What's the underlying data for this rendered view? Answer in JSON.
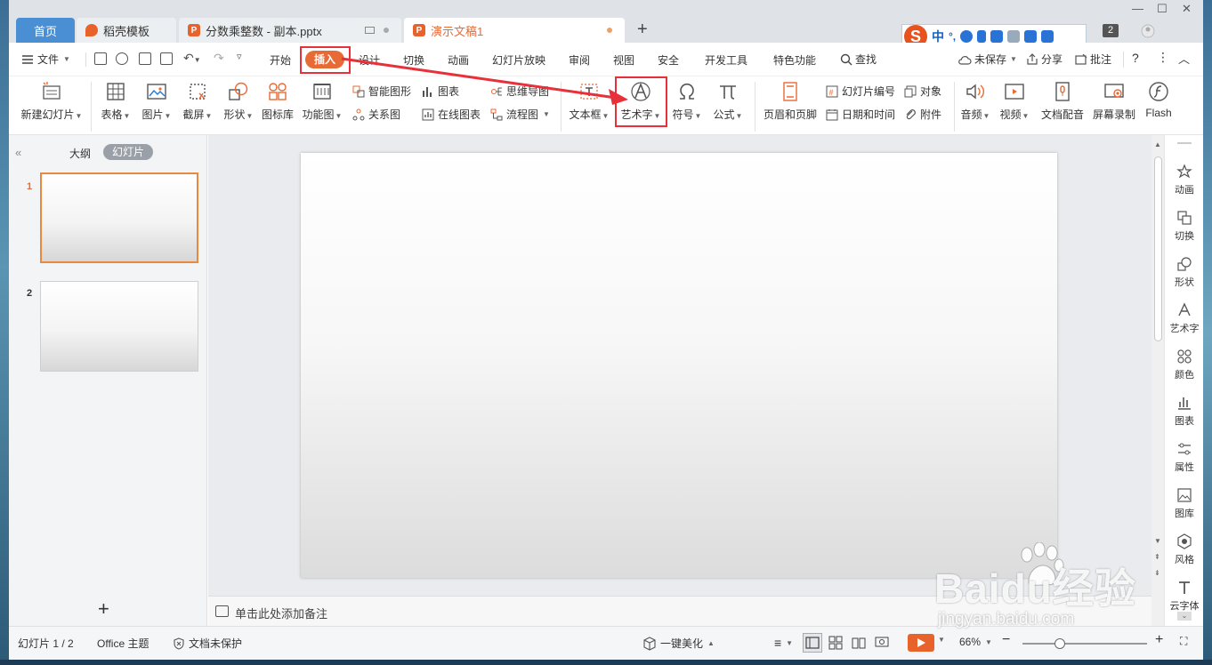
{
  "tabs": [
    {
      "label": "首页"
    },
    {
      "label": "稻壳模板"
    },
    {
      "label": "分数乘整数 - 副本.pptx"
    },
    {
      "label": "演示文稿1"
    }
  ],
  "titlebar": {
    "badge": "2"
  },
  "ime": {
    "label": "中"
  },
  "menu": {
    "file": "文件",
    "items": [
      "开始",
      "插入",
      "设计",
      "切换",
      "动画",
      "幻灯片放映",
      "审阅",
      "视图",
      "安全",
      "开发工具",
      "特色功能"
    ],
    "search": "查找",
    "unsaved": "未保存",
    "share": "分享",
    "annotate": "批注",
    "help": "?"
  },
  "ribbon": {
    "new_slide": "新建幻灯片",
    "table": "表格",
    "picture": "图片",
    "screenshot": "截屏",
    "shape": "形状",
    "icon_lib": "图标库",
    "func_chart": "功能图",
    "smart_shape": "智能图形",
    "relation": "关系图",
    "chart": "图表",
    "online_chart": "在线图表",
    "mindmap": "思维导图",
    "flowchart": "流程图",
    "textbox": "文本框",
    "wordart": "艺术字",
    "symbol": "符号",
    "formula": "公式",
    "header_footer": "页眉和页脚",
    "slide_number": "幻灯片编号",
    "date_time": "日期和时间",
    "object": "对象",
    "attachment": "附件",
    "audio": "音频",
    "video": "视频",
    "dubbing": "文档配音",
    "screen_record": "屏幕录制",
    "flash": "Flash"
  },
  "left_panel": {
    "outline": "大纲",
    "slides": "幻灯片",
    "slide_numbers": [
      "1",
      "2"
    ]
  },
  "notes": {
    "placeholder": "单击此处添加备注"
  },
  "right_sidebar": [
    "动画",
    "切换",
    "形状",
    "艺术字",
    "颜色",
    "图表",
    "属性",
    "图库",
    "风格",
    "云字体"
  ],
  "status": {
    "slide_info": "幻灯片 1 / 2",
    "theme": "Office 主题",
    "protection": "文档未保护",
    "beautify": "一键美化",
    "zoom": "66%",
    "zoom_fraction": 0.3
  },
  "watermark": {
    "brand": "Baidu经验",
    "url": "jingyan.baidu.com"
  },
  "colors": {
    "accent": "#e86a35",
    "highlight_box": "#e8303a",
    "home_tab": "#4a8fd4"
  }
}
